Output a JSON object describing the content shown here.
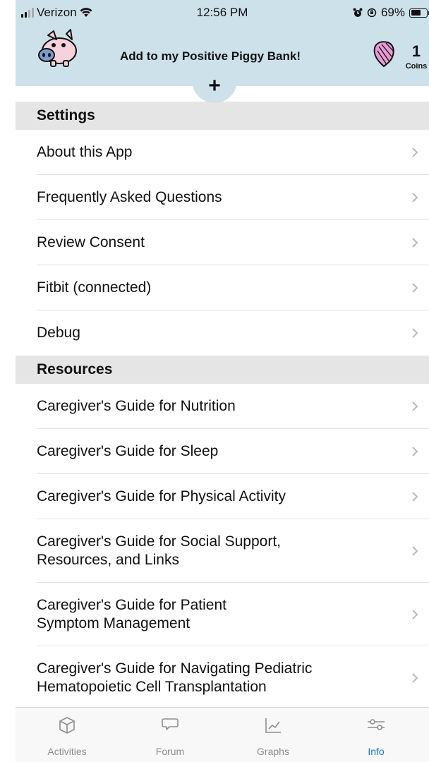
{
  "status_bar": {
    "carrier": "Verizon",
    "time": "12:56 PM",
    "battery": "69%",
    "battery_level": 0.69
  },
  "header": {
    "title": "Add to my Positive Piggy Bank!",
    "coins_count": "1",
    "coins_label": "Coins",
    "add_symbol": "+",
    "icons": {
      "logo": "piggy-bank-icon",
      "coin": "gem-coin-icon"
    }
  },
  "sections": {
    "settings": {
      "title": "Settings",
      "items": [
        {
          "label": "About this App"
        },
        {
          "label": "Frequently Asked Questions"
        },
        {
          "label": "Review Consent"
        },
        {
          "label": "Fitbit (connected)"
        },
        {
          "label": "Debug"
        }
      ]
    },
    "resources": {
      "title": "Resources",
      "items": [
        {
          "label": "Caregiver's Guide for Nutrition"
        },
        {
          "label": "Caregiver's Guide for Sleep"
        },
        {
          "label": "Caregiver's Guide for Physical Activity"
        },
        {
          "label": "Caregiver's Guide for Social Support, Resources, and Links"
        },
        {
          "label": "Caregiver's Guide for Patient Symptom Management"
        },
        {
          "label": "Caregiver's Guide for Navigating Pediatric Hematopoietic Cell Transplantation"
        }
      ]
    }
  },
  "tabbar": {
    "tabs": [
      {
        "label": "Activities",
        "icon": "cube-icon"
      },
      {
        "label": "Forum",
        "icon": "chat-bubble-icon"
      },
      {
        "label": "Graphs",
        "icon": "chart-icon"
      },
      {
        "label": "Info",
        "icon": "sliders-icon",
        "active": true
      }
    ]
  },
  "colors": {
    "header_bg": "#cde1eb",
    "section_bg": "#e5e5e5",
    "active_tab": "#1a73e8",
    "inactive_tab": "#8e8e93"
  }
}
